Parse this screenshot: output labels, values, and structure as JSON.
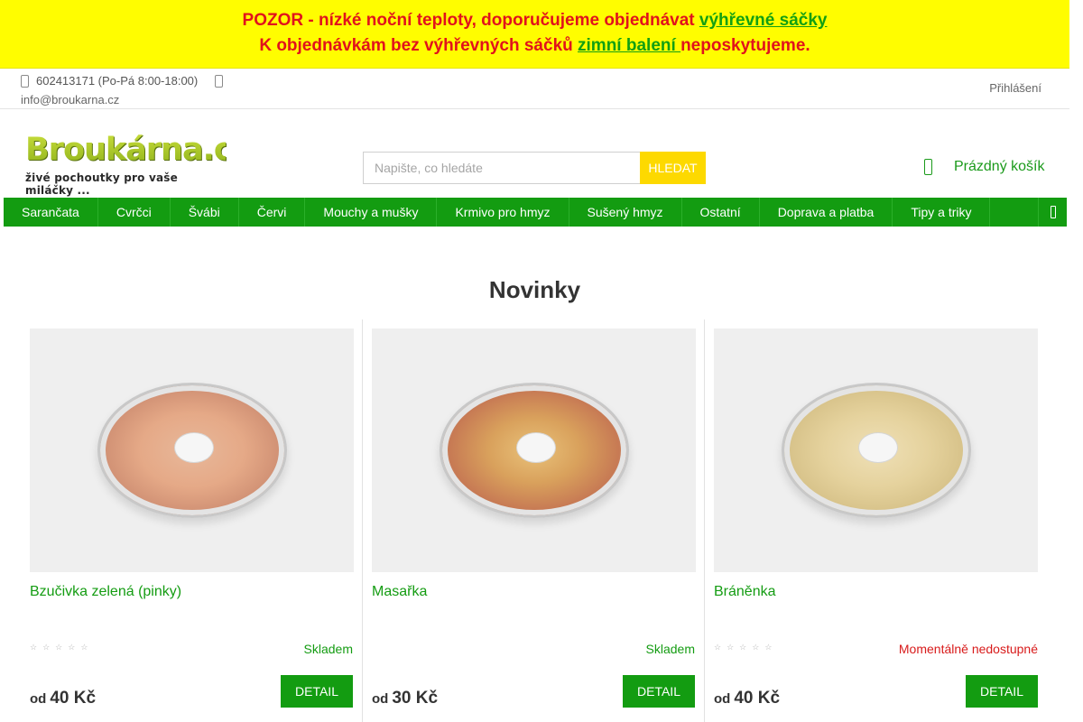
{
  "notice": {
    "line1_text": "POZOR - nízké noční teploty, doporučujeme objednávat ",
    "line1_link": "výhřevné sáčky",
    "line2_text": "K objednávkám bez výhřevných sáčků ",
    "line2_link": "zimní balení ",
    "line2_end": "neposkytujeme."
  },
  "topbar": {
    "phone": "602413171 (Po-Pá 8:00-18:00)",
    "email": "info@broukarna.cz",
    "login": "Přihlášení"
  },
  "header": {
    "logo_text": "Broukárna.cz",
    "tagline": "živé pochoutky pro vaše miláčky ...",
    "search_placeholder": "Napište, co hledáte",
    "search_button": "HLEDAT",
    "cart_label": "Prázdný košík"
  },
  "nav": {
    "items": [
      "Sarančata",
      "Cvrčci",
      "Švábi",
      "Červi",
      "Mouchy a mušky",
      "Krmivo pro hmyz",
      "Sušený hmyz",
      "Ostatní",
      "Doprava a platba",
      "Tipy a triky"
    ]
  },
  "section": {
    "title": "Novinky"
  },
  "products": [
    {
      "name": "Bzučivka zelená (pinky)",
      "stock": "Skladem",
      "price_prefix": "od",
      "price": "40 Kč",
      "button": "DETAIL",
      "rating": "0/5"
    },
    {
      "name": "Masařka",
      "stock": "Skladem",
      "price_prefix": "od",
      "price": "30 Kč",
      "button": "DETAIL"
    },
    {
      "name": "Bráněnka",
      "stock": "Momentálně nedostupné",
      "price_prefix": "od",
      "price": "40 Kč",
      "button": "DETAIL",
      "rating": "0/5"
    }
  ],
  "colors": {
    "brand_green": "#139c11",
    "notice_yellow": "#fffd00",
    "notice_red": "#e1121c",
    "search_yellow": "#fdd900",
    "out_of_stock_red": "#d81b1b"
  }
}
